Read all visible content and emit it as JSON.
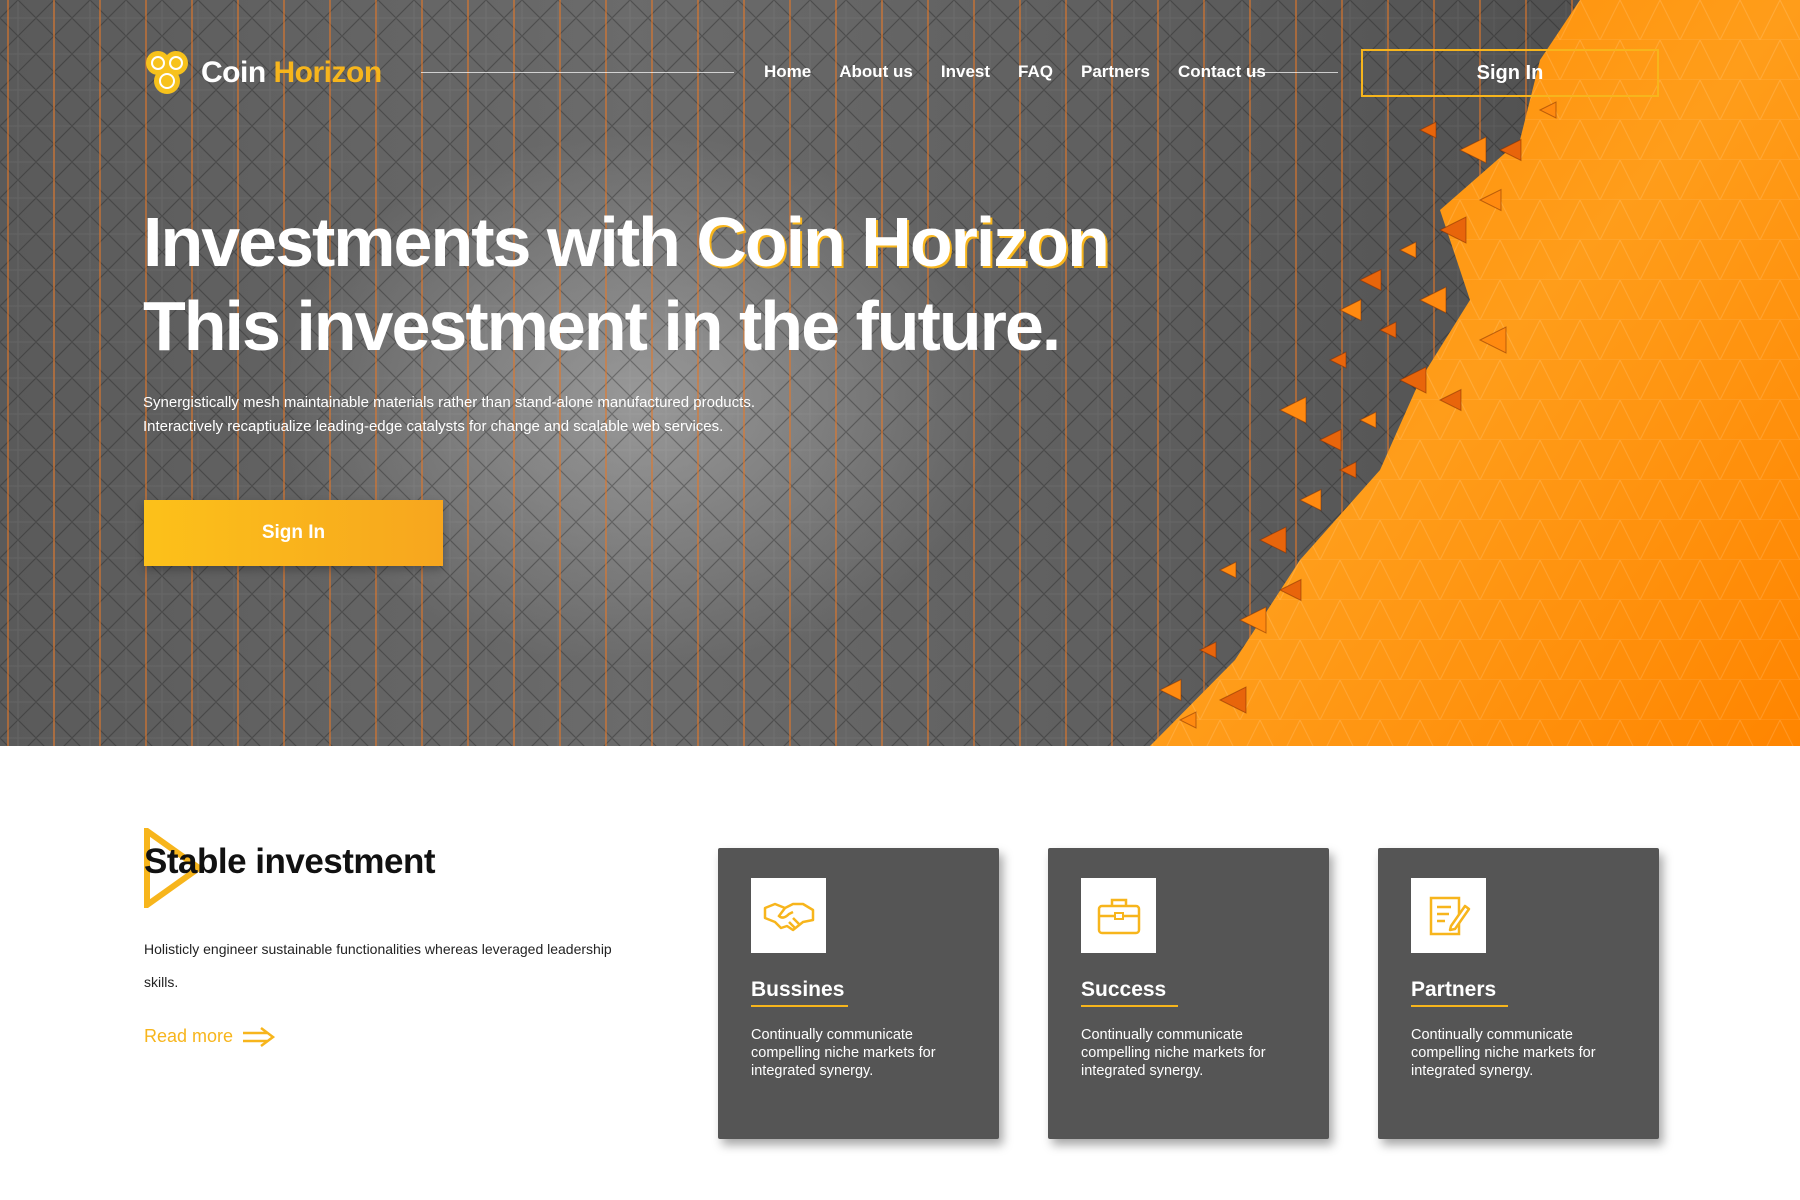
{
  "brand": {
    "name_part1": "Coin",
    "name_part2": "Horizon",
    "accent_color": "#f7b51c",
    "logo_icon": "coins-icon"
  },
  "nav": {
    "items": [
      "Home",
      "About us",
      "Invest",
      "FAQ",
      "Partners",
      "Contact us"
    ],
    "signin_label": "Sign In"
  },
  "hero": {
    "title_line1_part1": "Investments with ",
    "title_line1_part2": "Coin Horizon",
    "title_line2": "This investment in the future.",
    "desc_line1": "Synergistically mesh maintainable materials rather than stand-alone manufactured products.",
    "desc_line2": "Interactively recaptiualize leading-edge catalysts for change and scalable web services.",
    "cta_label": "Sign In",
    "bg_colors": {
      "dark": "#5c5c5c",
      "orange": "#ff9412"
    }
  },
  "stable": {
    "title": "Stable investment",
    "text": "Holisticly engineer sustainable functionalities whereas leveraged leadership skills.",
    "read_more": "Read more",
    "read_more_icon": "arrow-right-icon"
  },
  "cards": [
    {
      "icon": "handshake-icon",
      "title": "Bussines",
      "text": "Continually communicate compelling niche markets for integrated synergy."
    },
    {
      "icon": "briefcase-icon",
      "title": "Success",
      "text": "Continually communicate compelling niche markets for integrated synergy."
    },
    {
      "icon": "document-edit-icon",
      "title": "Partners",
      "text": "Continually communicate compelling niche markets for integrated synergy."
    }
  ],
  "card_bg": "#555555"
}
